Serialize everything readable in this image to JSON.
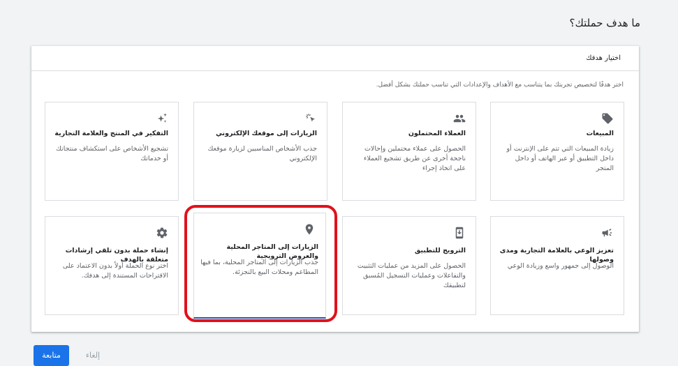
{
  "page": {
    "title": "ما هدف حملتك؟"
  },
  "panel": {
    "header": "اختيار هدفك",
    "description": "اختر هدفًا لتخصيص تجربتك بما يتناسب مع الأهداف والإعدادات التي تناسب حملتك بشكل أفضل."
  },
  "cards": [
    {
      "icon": "tag-icon",
      "title": "المبيعات",
      "description": "زيادة المبيعات التي تتم على الإنترنت أو داخل التطبيق أو عبر الهاتف أو داخل المتجر"
    },
    {
      "icon": "people-icon",
      "title": "العملاء المحتملون",
      "description": "الحصول على عملاء محتملين وإحالات ناجحة أخرى عن طريق تشجيع العملاء على اتخاذ إجراء"
    },
    {
      "icon": "cursor-click-icon",
      "title": "الزيارات إلى موقعك الإلكتروني",
      "description": "جذب الأشخاص المناسبين لزيارة موقعك الإلكتروني"
    },
    {
      "icon": "sparkle-icon",
      "title": "التفكير في المنتج والعلامة التجارية",
      "description": "تشجيع الأشخاص على استكشاف منتجاتك أو خدماتك"
    },
    {
      "icon": "megaphone-icon",
      "title": "تعزيز الوعي بالعلامة التجارية ومدى وصولها",
      "description": "الوصول إلى جمهور واسع وزيادة الوعي"
    },
    {
      "icon": "phone-download-icon",
      "title": "الترويج للتطبيق",
      "description": "الحصول على المزيد من عمليات التثبيت والتفاعلات وعمليات التسجيل المُسبق لتطبيقك"
    },
    {
      "icon": "location-pin-icon",
      "title": "الزيارات إلى المتاجر المحلية والعروض الترويجية",
      "description": "جذب الزيارات إلى المتاجر المحلية، بما فيها المطاعم ومحلات البيع بالتجزئة."
    },
    {
      "icon": "gear-icon",
      "title": "إنشاء حملة بدون تلقي إرشادات متعلقة بالهدف",
      "description": "اختر نوع الحملة أولاً بدون الاعتماد على الاقتراحات المستندة إلى هدفك."
    }
  ],
  "footer": {
    "continue_label": "متابعة",
    "cancel_label": "إلغاء"
  },
  "colors": {
    "accent": "#1a73e8",
    "highlight": "#e0111c"
  }
}
